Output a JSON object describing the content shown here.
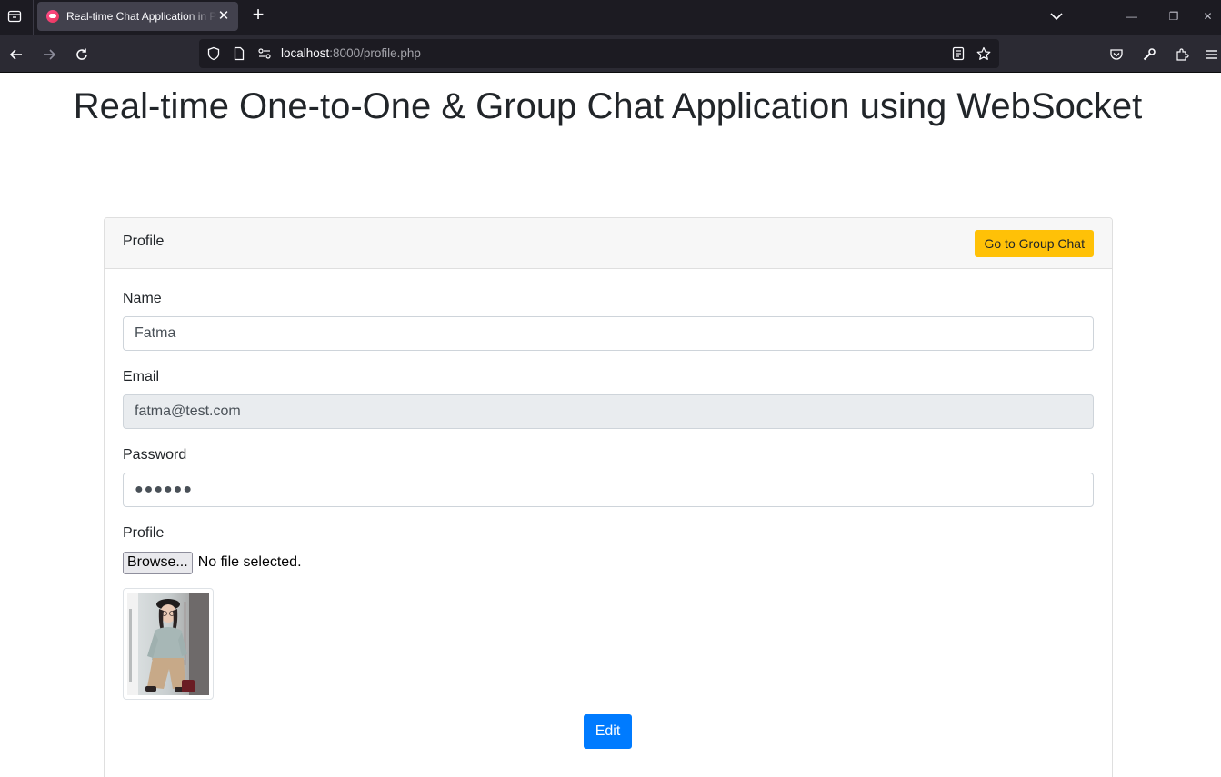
{
  "browser": {
    "tab_title": "Real-time Chat Application in PHP",
    "new_tab_symbol": "+",
    "close_symbol": "✕",
    "url_host": "localhost",
    "url_rest": ":8000/profile.php",
    "window_controls": {
      "minimize": "—",
      "restore": "❐",
      "close": "✕"
    }
  },
  "page": {
    "title": "Real-time One-to-One & Group Chat Application using WebSocket"
  },
  "card": {
    "header_title": "Profile",
    "group_chat_button": "Go to Group Chat"
  },
  "form": {
    "name_label": "Name",
    "name_value": "Fatma",
    "email_label": "Email",
    "email_value": "fatma@test.com",
    "password_label": "Password",
    "password_mask": "●●●●●●",
    "profile_label": "Profile",
    "browse_button": "Browse...",
    "file_status": "No file selected.",
    "edit_button": "Edit"
  },
  "colors": {
    "warning": "#ffc107",
    "primary": "#007bff",
    "browser_dark": "#1c1b22"
  },
  "icons": [
    "tab-list-icon",
    "back-arrow-icon",
    "forward-arrow-icon",
    "reload-icon",
    "shield-icon",
    "page-icon",
    "permissions-icon",
    "reader-view-icon",
    "bookmark-star-icon",
    "pocket-icon",
    "wrench-icon",
    "extensions-icon",
    "hamburger-menu-icon"
  ]
}
